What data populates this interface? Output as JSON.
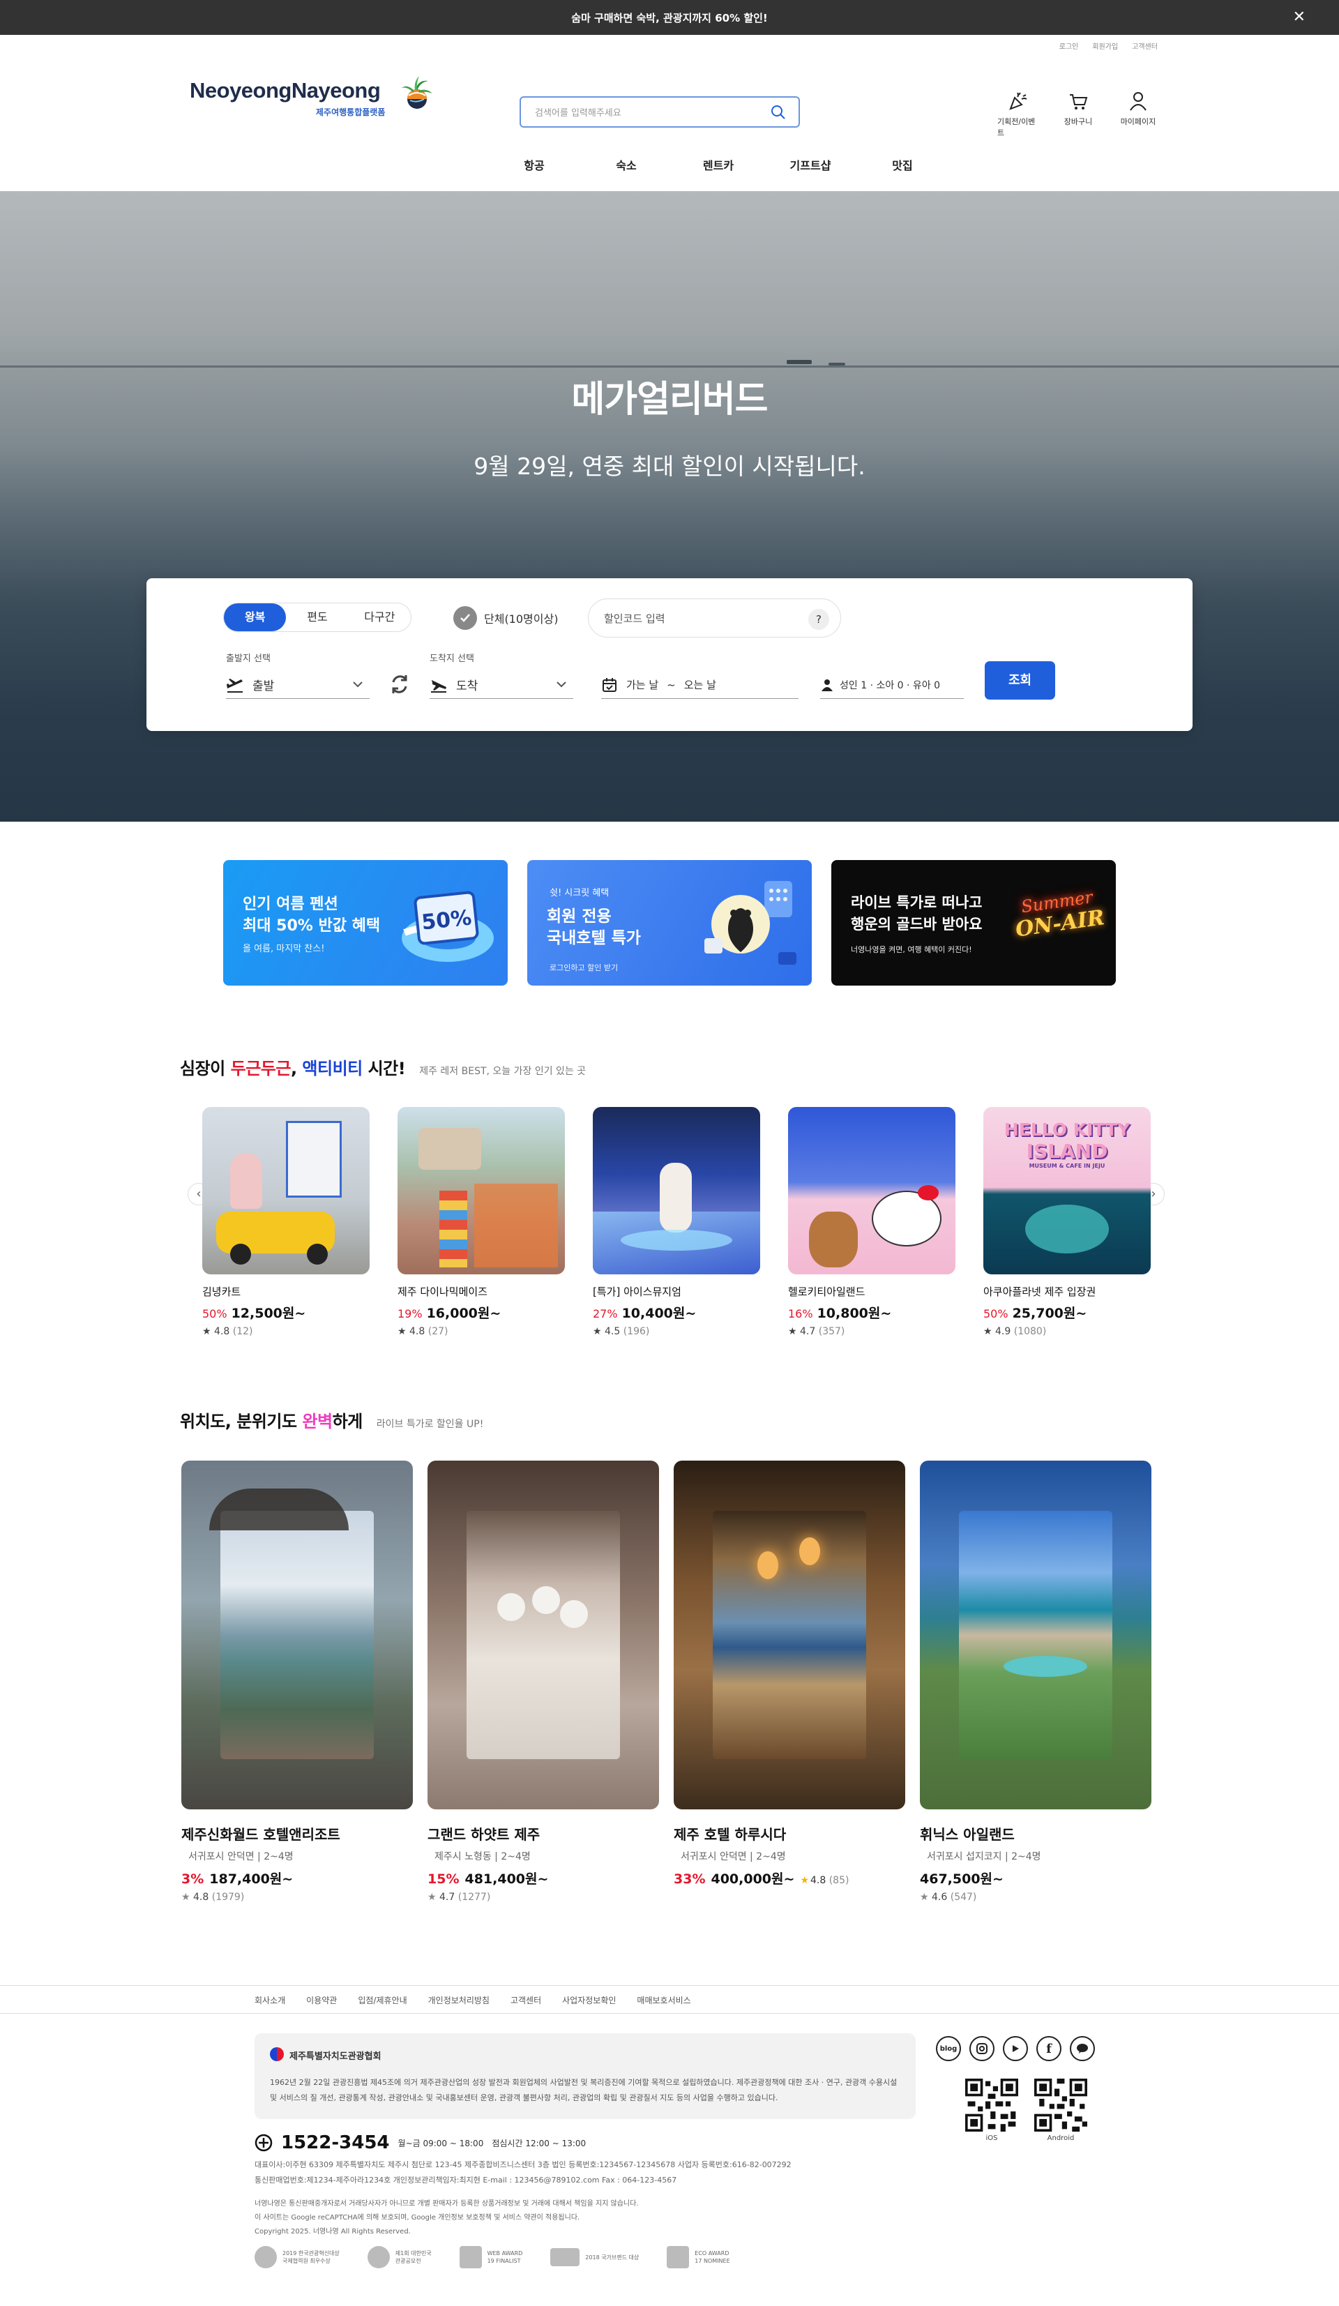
{
  "topbar": {
    "message": "숨마 구매하면 숙박, 관광지까지 60% 할인!"
  },
  "util": [
    "로그인",
    "회원가입",
    "고객센터"
  ],
  "logo": {
    "main": "NeoyeongNayeong",
    "sub": "제주여행통합플랫폼"
  },
  "search": {
    "placeholder": "검색어를 입력해주세요"
  },
  "header_icons": [
    {
      "icon": "party-popper-icon",
      "label": "기획전/이벤트"
    },
    {
      "icon": "cart-icon",
      "label": "장바구니"
    },
    {
      "icon": "user-icon",
      "label": "마이페이지"
    }
  ],
  "gnb": [
    "항공",
    "숙소",
    "렌트카",
    "기프트샵",
    "맛집"
  ],
  "hero": {
    "title": "메가얼리버드",
    "subtitle": "9월 29일, 연중 최대 할인이 시작됩니다."
  },
  "booking": {
    "trip_types": [
      "왕복",
      "편도",
      "다구간"
    ],
    "selected_trip": "왕복",
    "group_label": "단체(10명이상)",
    "coupon_placeholder": "할인코드 입력",
    "coupon_help": "?",
    "departure_label": "출발지 선택",
    "departure_value": "출발",
    "arrival_label": "도착지 선택",
    "arrival_value": "도착",
    "date_go": "가는 날",
    "date_sep": "~",
    "date_back": "오는 날",
    "passengers": "성인 1 · 소아 0 · 유아 0",
    "submit": "조회"
  },
  "banners": [
    {
      "line1": "인기 여름 펜션",
      "line2": "최대 50% 반값 혜택",
      "line3": "올 여름, 마지막 찬스!",
      "badge": "50%",
      "color": "#2a8cf0"
    },
    {
      "line0": "쉿! 시크릿 혜택",
      "line1": "회원 전용",
      "line2": "국내호텔 특가",
      "line3": "로그인하고 할인 받기",
      "color": "#3a7ef2"
    },
    {
      "line1": "라이브 특가로 떠나고",
      "line2": "행운의 골드바 받아요",
      "line3": "너영나영을 켜면, 여행 혜택이 커진다!",
      "neon1": "Summer",
      "neon2": "ON-AIR",
      "color": "#0b0b0b"
    }
  ],
  "activity_section": {
    "title_a": "심장이 ",
    "title_b": "두근두근",
    "title_c": ", ",
    "title_d": "액티비티",
    "title_e": " 시간!",
    "desc": "제주 레저 BEST, 오늘 가장 인기 있는 곳",
    "prev": "‹",
    "next": "›",
    "items": [
      {
        "name": "김녕카트",
        "discount": "50%",
        "price": "12,500원~",
        "rating": "4.8",
        "reviews": "(12)"
      },
      {
        "name": "제주 다이나믹메이즈",
        "discount": "19%",
        "price": "16,000원~",
        "rating": "4.8",
        "reviews": "(27)"
      },
      {
        "name": "[특가] 아이스뮤지엄",
        "discount": "27%",
        "price": "10,400원~",
        "rating": "4.5",
        "reviews": "(196)"
      },
      {
        "name": "헬로키티아일랜드",
        "discount": "16%",
        "price": "10,800원~",
        "rating": "4.7",
        "reviews": "(357)"
      },
      {
        "name": "아쿠아플라넷 제주 입장권",
        "discount": "50%",
        "price": "25,700원~",
        "rating": "4.9",
        "reviews": "(1080)"
      }
    ],
    "hello_kitty_sign1": "HELLO KITTY",
    "hello_kitty_sign2": "ISLAND",
    "hello_kitty_sign3": "MUSEUM & CAFE IN JEJU"
  },
  "hotel_section": {
    "title_a": "위치도, 분위기도 ",
    "title_b": "완벽",
    "title_c": "하게",
    "desc": "라이브 특가로 할인율 UP!",
    "items": [
      {
        "name": "제주신화월드 호텔앤리조트",
        "loc": "서귀포시 안덕면 | 2~4명",
        "discount": "3%",
        "price": "187,400원~",
        "rating": "4.8",
        "reviews": "(1979)"
      },
      {
        "name": "그랜드 하얏트 제주",
        "loc": "제주시 노형동 | 2~4명",
        "discount": "15%",
        "price": "481,400원~",
        "rating": "4.7",
        "reviews": "(1277)"
      },
      {
        "name": "제주 호텔 하루시다",
        "loc": "서귀포시 안덕면 | 2~4명",
        "discount": "33%",
        "price": "400,000원~",
        "rating": "4.8",
        "reviews": "(85)",
        "inline_rating": true
      },
      {
        "name": "휘닉스 아일랜드",
        "loc": "서귀포시 섭지코지 | 2~4명",
        "discount": "",
        "price": "467,500원~",
        "rating": "4.6",
        "reviews": "(547)"
      }
    ]
  },
  "footer": {
    "menu": [
      "회사소개",
      "이용약관",
      "입점/제휴안내",
      "개인정보처리방침",
      "고객센터",
      "사업자정보확인",
      "매매보호서비스"
    ],
    "assoc_title": "제주특별자치도관광협회",
    "assoc_text": "1962년 2월 22일 관광진흥법 제45조에 의거 제주관광산업의 성장 발전과 회원업체의 사업발전 및 복리증진에 기여할 목적으로 설립하였습니다. 제주관광정책에 대한 조사 · 연구, 관광객 수용시설 및 서비스의 질 개선, 관광통계 작성, 관광안내소 및 국내홍보센터 운영, 관광객 불편사항 처리, 관광업의 확립 및 관광질서 지도 등의 사업을 수행하고 있습니다.",
    "social": [
      "blog",
      "instagram",
      "youtube",
      "facebook",
      "kakao"
    ],
    "qr_labels": [
      "iOS",
      "Android"
    ],
    "phone": "1522-3454",
    "hours": "월~금 09:00 ~ 18:00",
    "lunch": "점심시간 12:00 ~ 13:00",
    "info1": "대표이사:이주현    63309 제주특별자치도 제주시 첨단로 123-45 제주종합비즈니스센터 3층    법인 등록번호:1234567-12345678    사업자 등록번호:616-82-007292",
    "info2": "통신판매업번호:제1234-제주아라1234호    개인정보관리책임자:최지현    E-mail : 123456@789102.com    Fax : 064-123-4567",
    "notice1": "너영나영은 통신판매중개자로서 거래당사자가 아니므로 개별 판매자가 등록한 상품거래정보 및 거래에 대해서 책임을 지지 않습니다.",
    "notice2": "이 사이트는 Google reCAPTCHA에 의해 보호되며, Google 개인정보 보호정책 및 서비스 약관이 적용됩니다.",
    "copyright": "Copyright 2025. 너영나영 All Rights Reserved.",
    "awards": [
      {
        "l1": "2019 한국관광혁신대상",
        "l2": "국제협력원 최우수상"
      },
      {
        "l1": "제1회 대한민국",
        "l2": "관광공모전"
      },
      {
        "l1": "WEB AWARD",
        "l2": "19 FINALIST"
      },
      {
        "l1": "2018 국가브랜드 대상",
        "l2": ""
      },
      {
        "l1": "ECO AWARD",
        "l2": "17 NOMINEE"
      }
    ]
  }
}
